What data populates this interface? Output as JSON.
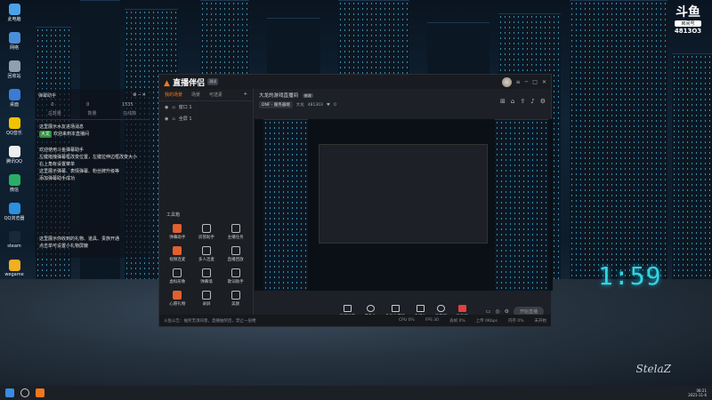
{
  "desktop": {
    "icons": [
      {
        "label": "此电脑",
        "color": "#4aa3e8"
      },
      {
        "label": "网络",
        "color": "#4a8fd8"
      },
      {
        "label": "回收站",
        "color": "#8fa0b0"
      },
      {
        "label": "桌面",
        "color": "#3a7bd5"
      },
      {
        "label": "QQ音乐",
        "color": "#f2c200"
      },
      {
        "label": "腾讯QQ",
        "color": "#eeeeee"
      },
      {
        "label": "微信",
        "color": "#2aae67"
      },
      {
        "label": "QQ浏览器",
        "color": "#2a90e0"
      },
      {
        "label": "steam",
        "color": "#1b2838"
      },
      {
        "label": "wegame",
        "color": "#f0b020"
      }
    ],
    "watermark": {
      "logo": "斗鱼",
      "label": "房间号",
      "room": "4813O3"
    },
    "clock": "1:59",
    "signature": "StelaZ"
  },
  "danmu": {
    "title": "弹幕助手",
    "stats": [
      "0",
      "0",
      "1535"
    ],
    "tabs": [
      "总数量",
      "数量",
      "在线数"
    ],
    "messages": [
      {
        "text": "这里展示水友进场消息"
      },
      {
        "tag": "大龙",
        "text": "欢迎来到本直播间"
      },
      {
        "text": "欢迎使用斗鱼弹幕助手"
      },
      {
        "text": "左键拖拽弹幕框改变位置，左键拉伸边框改变大小"
      },
      {
        "text": "右上角有设置菜单"
      },
      {
        "text": "这里展示弹幕、表情弹幕、粉丝牌升级等"
      },
      {
        "text": "添加弹幕助手成功"
      },
      {
        "text": "这里展示你收到的礼物、道具、贵族开通"
      },
      {
        "text": "点击单可设置小礼物屏蔽"
      }
    ]
  },
  "app": {
    "brand": "直播伴侣",
    "version": "测试",
    "scene_tabs": [
      "我的场景",
      "场景",
      "可选素"
    ],
    "scenes": [
      "窗口 1",
      "全屏 1"
    ],
    "tools_title": "工具箱",
    "tools": [
      "弹幕助手",
      "房管助手",
      "主播任务",
      "视频连麦",
      "多人连麦",
      "直播回放",
      "虚拟形象",
      "弹幕墙",
      "歌词助手",
      "心愿礼物",
      "录屏",
      "美颜"
    ],
    "room_title": "大龙的游戏直播间",
    "room_badge": "修改",
    "room_chip": "DNF · 服务器端",
    "room_streamer": "大龙",
    "room_id": "481303",
    "room_fans": "0",
    "controls": [
      "直播屏幕",
      "摄像头",
      "多机位游戏",
      "多媒体",
      "麦克风",
      "扬声器"
    ],
    "start_label": "开始直播",
    "status": {
      "notice": "斗鱼公告：抽奖无须同意，直播抽奖后，禁止一层楼",
      "cpu": "CPU 0%",
      "fps": "FPS 30",
      "loss": "丢帧 0%",
      "speed": "上传 0Kbps",
      "mem": "内存 0%",
      "time": "未开始"
    }
  },
  "taskbar": {
    "time": "08:21",
    "date": "2021-11-6"
  }
}
